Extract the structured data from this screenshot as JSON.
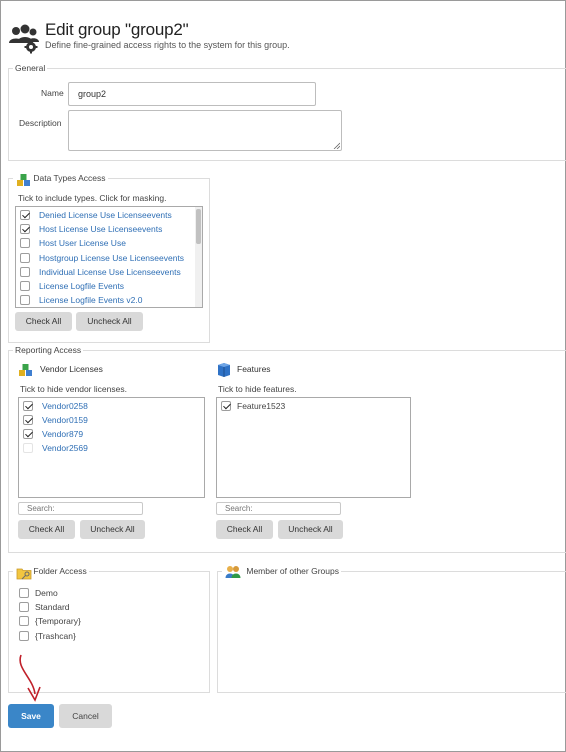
{
  "header": {
    "title": "Edit group \"group2\"",
    "subtitle": "Define fine-grained access rights to the system for this group.",
    "icon": "users-gear-icon"
  },
  "general": {
    "legend": "General",
    "name_label": "Name",
    "name_value": "group2",
    "description_label": "Description",
    "description_value": ""
  },
  "data_types": {
    "legend": "Data Types Access",
    "hint": "Tick to include types. Click for masking.",
    "items": [
      {
        "label": "Denied License Use Licenseevents",
        "checked": true
      },
      {
        "label": "Host License Use Licenseevents",
        "checked": true
      },
      {
        "label": "Host User License Use",
        "checked": false
      },
      {
        "label": "Hostgroup License Use Licenseevents",
        "checked": false
      },
      {
        "label": "Individual License Use Licenseevents",
        "checked": false
      },
      {
        "label": "License Logfile Events",
        "checked": false
      },
      {
        "label": "License Logfile Events v2.0",
        "checked": false
      }
    ],
    "check_all": "Check All",
    "uncheck_all": "Uncheck All"
  },
  "reporting": {
    "legend": "Reporting Access",
    "vendor": {
      "title": "Vendor Licenses",
      "hint": "Tick to hide vendor licenses.",
      "items": [
        {
          "label": "Vendor0258",
          "checked": true
        },
        {
          "label": "Vendor0159",
          "checked": true
        },
        {
          "label": "Vendor879",
          "checked": true
        },
        {
          "label": "Vendor2569",
          "checked": false
        }
      ],
      "search_placeholder": "Search:",
      "check_all": "Check All",
      "uncheck_all": "Uncheck All"
    },
    "features": {
      "title": "Features",
      "hint": "Tick to hide features.",
      "items": [
        {
          "label": "Feature1523",
          "checked": true
        }
      ],
      "search_placeholder": "Search:",
      "check_all": "Check All",
      "uncheck_all": "Uncheck All"
    }
  },
  "folders": {
    "legend": "Folder Access",
    "items": [
      {
        "label": "Demo",
        "checked": false
      },
      {
        "label": "Standard",
        "checked": false
      },
      {
        "label": "{Temporary}",
        "checked": false
      },
      {
        "label": "{Trashcan}",
        "checked": false
      }
    ]
  },
  "member_groups": {
    "legend": "Member of other Groups"
  },
  "actions": {
    "save": "Save",
    "cancel": "Cancel"
  },
  "colors": {
    "link": "#2f6fb5",
    "save_button": "#3a86c8",
    "annotation_arrow": "#c0202a"
  }
}
